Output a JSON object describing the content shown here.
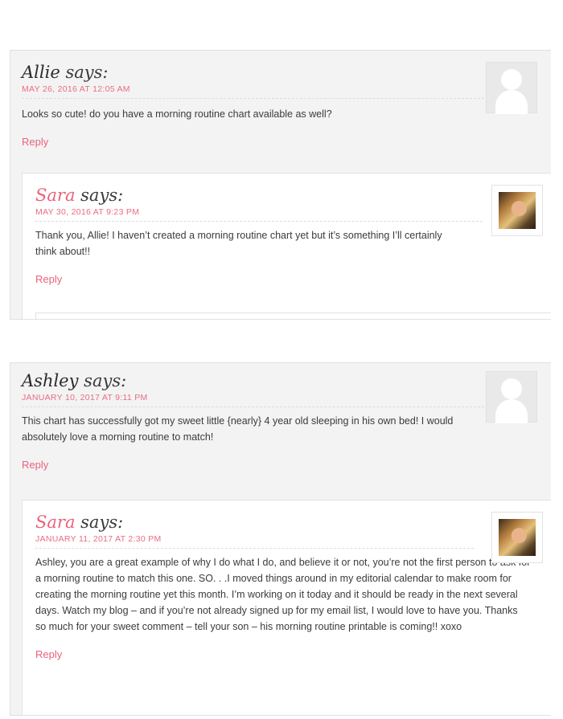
{
  "comments": [
    {
      "author": "Allie",
      "says": "says:",
      "date": "MAY 26, 2016 AT 12:05 AM",
      "text": "Looks so cute! do you have a morning routine chart available as well?",
      "reply_label": "Reply",
      "reply": {
        "author": "Sara",
        "says": "says:",
        "date": "MAY 30, 2016 AT 9:23 PM",
        "text": "Thank you, Allie! I haven’t created a morning routine chart yet but it’s something I’ll certainly think about!!",
        "reply_label": "Reply"
      }
    },
    {
      "author": "Ashley",
      "says": "says:",
      "date": "JANUARY 10, 2017 AT 9:11 PM",
      "text": "This chart has successfully got my sweet little {nearly} 4 year old sleeping in his own bed! I would absolutely love a morning routine to match!",
      "reply_label": "Reply",
      "reply": {
        "author": "Sara",
        "says": "says:",
        "date": "JANUARY 11, 2017 AT 2:30 PM",
        "text": "Ashley, you are a great example of why I do what I do, and believe it or not, you’re not the first person to ask for a morning routine to match this one. SO. . .I moved things around in my editorial calendar to make room for creating the morning routine yet this month. I’m working on it today and it should be ready in the next several days. Watch my blog – and if you’re not already signed up for my email list, I would love to have you. Thanks so much for your sweet comment – tell your son – his morning routine printable is coming!! xoxo",
        "reply_label": "Reply"
      }
    }
  ],
  "icons": {
    "default_avatar": "default-avatar-icon",
    "author_avatar": "author-photo-avatar"
  },
  "colors": {
    "accent": "#e9637b",
    "panel_bg": "#f3f3f3"
  }
}
